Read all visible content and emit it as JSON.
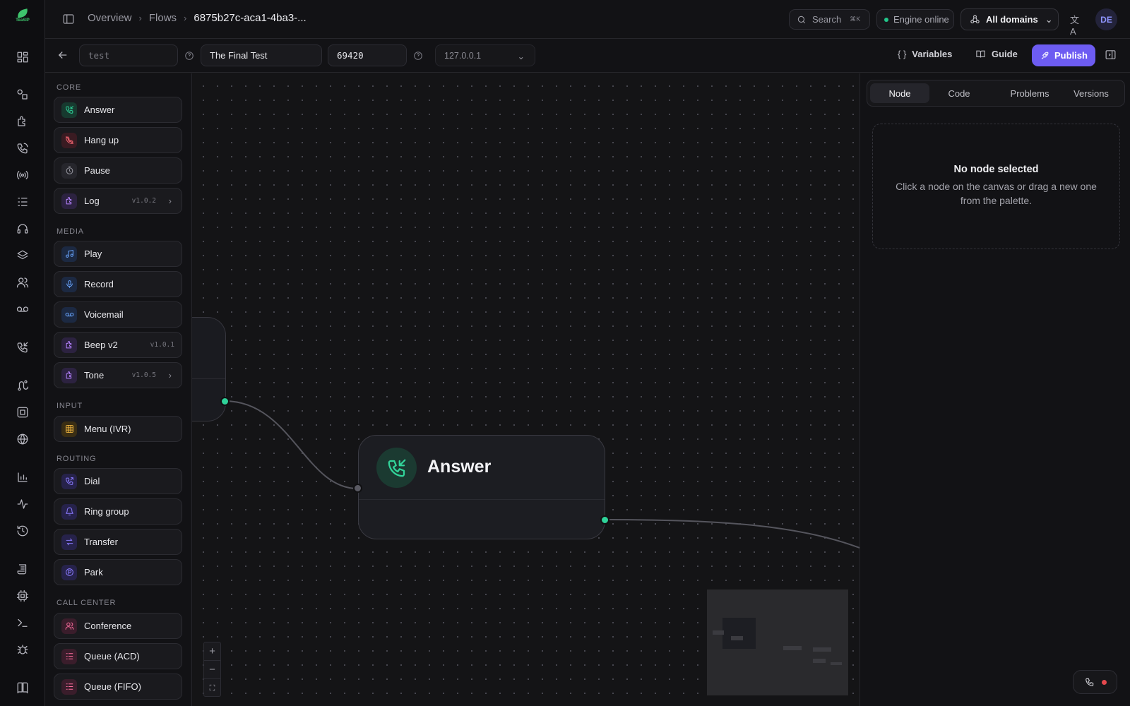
{
  "app": {
    "logo_text": "TeaSIP"
  },
  "breadcrumb": {
    "items": [
      "Overview",
      "Flows"
    ],
    "current": "6875b27c-aca1-4ba3-..."
  },
  "header": {
    "search_label": "Search",
    "search_shortcut": "⌘K",
    "engine_status": "Engine online",
    "domain_selector": "All domains",
    "avatar_initials": "DE"
  },
  "toolbar": {
    "slug_value": "test",
    "name_value": "The Final Test",
    "extension_value": "69420",
    "host_value": "127.0.0.1",
    "variables_label": "Variables",
    "guide_label": "Guide",
    "publish_label": "Publish"
  },
  "palette": {
    "sections": [
      {
        "title": "CORE",
        "items": [
          {
            "label": "Answer",
            "icon": "phone-incoming-icon",
            "color": "#2fd39a",
            "bg": "#173a2f"
          },
          {
            "label": "Hang up",
            "icon": "phone-off-icon",
            "color": "#f06470",
            "bg": "#3a1b22"
          },
          {
            "label": "Pause",
            "icon": "timer-icon",
            "color": "#9a9aa3",
            "bg": "#26262c"
          },
          {
            "label": "Log",
            "icon": "puzzle-icon",
            "color": "#b784ff",
            "bg": "#2c2240",
            "version": "v1.0.2",
            "has_arrow": true
          }
        ]
      },
      {
        "title": "MEDIA",
        "items": [
          {
            "label": "Play",
            "icon": "music-icon",
            "color": "#6aa6ff",
            "bg": "#1c2942"
          },
          {
            "label": "Record",
            "icon": "mic-icon",
            "color": "#6aa6ff",
            "bg": "#1c2942"
          },
          {
            "label": "Voicemail",
            "icon": "voicemail-icon",
            "color": "#6aa6ff",
            "bg": "#1c2942"
          },
          {
            "label": "Beep v2",
            "icon": "puzzle-icon",
            "color": "#b784ff",
            "bg": "#2c2240",
            "version": "v1.0.1"
          },
          {
            "label": "Tone",
            "icon": "puzzle-icon",
            "color": "#b784ff",
            "bg": "#2c2240",
            "version": "v1.0.5",
            "has_arrow": true
          }
        ]
      },
      {
        "title": "INPUT",
        "items": [
          {
            "label": "Menu (IVR)",
            "icon": "grid-icon",
            "color": "#f1b640",
            "bg": "#3a2e14"
          }
        ]
      },
      {
        "title": "ROUTING",
        "items": [
          {
            "label": "Dial",
            "icon": "phone-outgoing-icon",
            "color": "#8b7bff",
            "bg": "#26224a"
          },
          {
            "label": "Ring group",
            "icon": "bell-ring-icon",
            "color": "#8b7bff",
            "bg": "#26224a"
          },
          {
            "label": "Transfer",
            "icon": "arrows-swap-icon",
            "color": "#8b7bff",
            "bg": "#26224a"
          },
          {
            "label": "Park",
            "icon": "parking-icon",
            "color": "#8b7bff",
            "bg": "#26224a"
          }
        ]
      },
      {
        "title": "CALL CENTER",
        "items": [
          {
            "label": "Conference",
            "icon": "users-icon",
            "color": "#ff6fa0",
            "bg": "#3a1d2b"
          },
          {
            "label": "Queue (ACD)",
            "icon": "list-icon",
            "color": "#ff6fa0",
            "bg": "#3a1d2b"
          },
          {
            "label": "Queue (FIFO)",
            "icon": "list-icon",
            "color": "#ff6fa0",
            "bg": "#3a1d2b"
          }
        ]
      }
    ]
  },
  "canvas": {
    "node_title": "Answer"
  },
  "inspector": {
    "tabs": [
      "Node",
      "Code",
      "Problems",
      "Versions"
    ],
    "active_tab": "Node",
    "empty_title": "No node selected",
    "empty_text": "Click a node on the canvas or drag a new one from the palette."
  },
  "colors": {
    "accent": "#6d5cf2",
    "success": "#22c58a",
    "handle": "#2fd39a"
  }
}
